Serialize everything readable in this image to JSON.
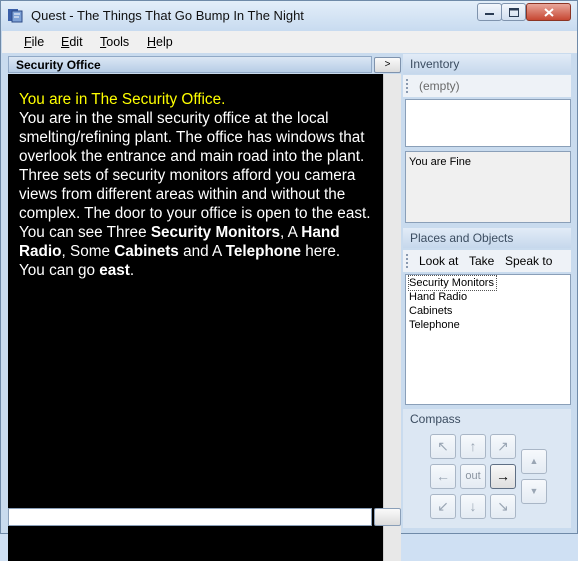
{
  "window": {
    "title": "Quest - The Things That Go Bump In The Night",
    "minimize_icon": "minimize-icon",
    "maximize_icon": "maximize-icon",
    "close_icon": "close-icon"
  },
  "menu": {
    "file": {
      "ul": "F",
      "rest": "ile"
    },
    "edit": {
      "ul": "E",
      "rest": "dit"
    },
    "tools": {
      "ul": "T",
      "rest": "ools"
    },
    "help": {
      "ul": "H",
      "rest": "elp"
    }
  },
  "location_bar": {
    "label": "Security Office",
    "button_label": ">"
  },
  "output": {
    "heading": "You are in The Security Office.",
    "description": "You are in the small security office at the local smelting/refining plant. The office has windows that overlook the entrance and main road into the plant. Three sets of security monitors afford you camera views from different areas within and without the complex. The door to your office is open to the east.",
    "see_prefix": "You can see Three ",
    "obj1": "Security Monitors",
    "sep1": ", A ",
    "obj2": "Hand Radio",
    "sep2": ", Some ",
    "obj3": "Cabinets",
    "sep3": " and A ",
    "obj4": "Telephone",
    "see_suffix": " here.",
    "go_prefix": "You can go ",
    "exit": "east",
    "go_suffix": "."
  },
  "inventory": {
    "header": "Inventory",
    "empty_label": "(empty)"
  },
  "status": {
    "text": "You are Fine"
  },
  "places": {
    "header": "Places and Objects",
    "buttons": {
      "look": "Look at",
      "take": "Take",
      "speak": "Speak to"
    },
    "items": [
      "Security Monitors",
      "Hand Radio",
      "Cabinets",
      "Telephone"
    ]
  },
  "compass": {
    "header": "Compass",
    "nw": "↖",
    "n": "↑",
    "ne": "↗",
    "w": "←",
    "out": "out",
    "e": "→",
    "sw": "↙",
    "s": "↓",
    "se": "↘",
    "up": "▲",
    "down": "▼",
    "active": "e"
  }
}
